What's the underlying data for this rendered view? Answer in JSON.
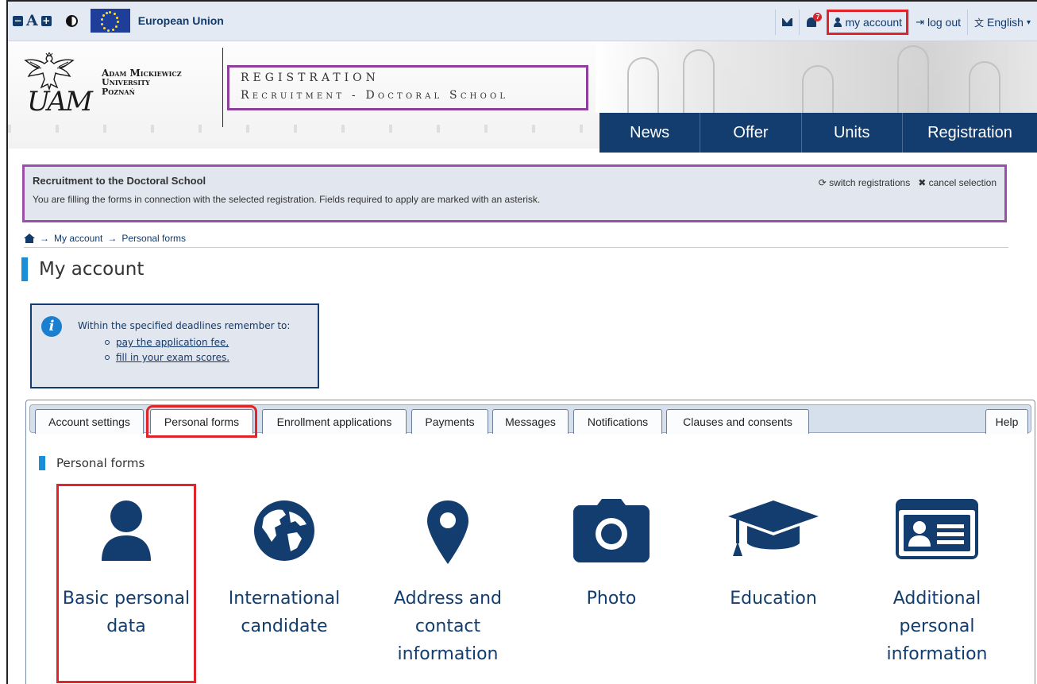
{
  "topbar": {
    "eu_label": "European Union",
    "a11y_minus": "−",
    "a11y_letter": "A",
    "a11y_plus": "+",
    "notifications_count": "7",
    "my_account": "my account",
    "log_out": "log out",
    "language": "English"
  },
  "header": {
    "uni_name": [
      "Adam Mickiewicz",
      "University",
      "Poznań"
    ],
    "logo_text": "UAM",
    "registration_title": "REGISTRATION",
    "registration_sub": "Recruitment - Doctoral School"
  },
  "nav": {
    "items": [
      "News",
      "Offer",
      "Units",
      "Registration"
    ]
  },
  "notice": {
    "title": "Recruitment to the Doctoral School",
    "text": "You are filling the forms in connection with the selected registration. Fields required to apply are marked with an asterisk.",
    "switch": "switch registrations",
    "cancel": "cancel selection"
  },
  "breadcrumb": {
    "arrow": "→",
    "items": [
      "My account",
      "Personal forms"
    ]
  },
  "page": {
    "title": "My account"
  },
  "info": {
    "lead": "Within the specified deadlines remember to:",
    "items": [
      "pay the application fee,",
      "fill in your exam scores."
    ]
  },
  "tabs": {
    "items": [
      "Account settings",
      "Personal forms",
      "Enrollment applications",
      "Payments",
      "Messages",
      "Notifications",
      "Clauses and consents"
    ],
    "help": "Help",
    "active": "Personal forms"
  },
  "section": {
    "title": "Personal forms"
  },
  "forms": {
    "items": [
      {
        "label": "Basic personal data",
        "icon": "user-icon"
      },
      {
        "label": "International candidate",
        "icon": "globe-icon"
      },
      {
        "label": "Address and contact information",
        "icon": "map-marker-icon"
      },
      {
        "label": "Photo",
        "icon": "camera-icon"
      },
      {
        "label": "Education",
        "icon": "graduation-cap-icon"
      },
      {
        "label": "Additional personal information",
        "icon": "id-card-icon"
      }
    ]
  },
  "colors": {
    "navy": "#123d6e",
    "accent_blue": "#1a8fd8",
    "highlight_red": "#e0242a",
    "highlight_purple": "#8e3f9b"
  }
}
